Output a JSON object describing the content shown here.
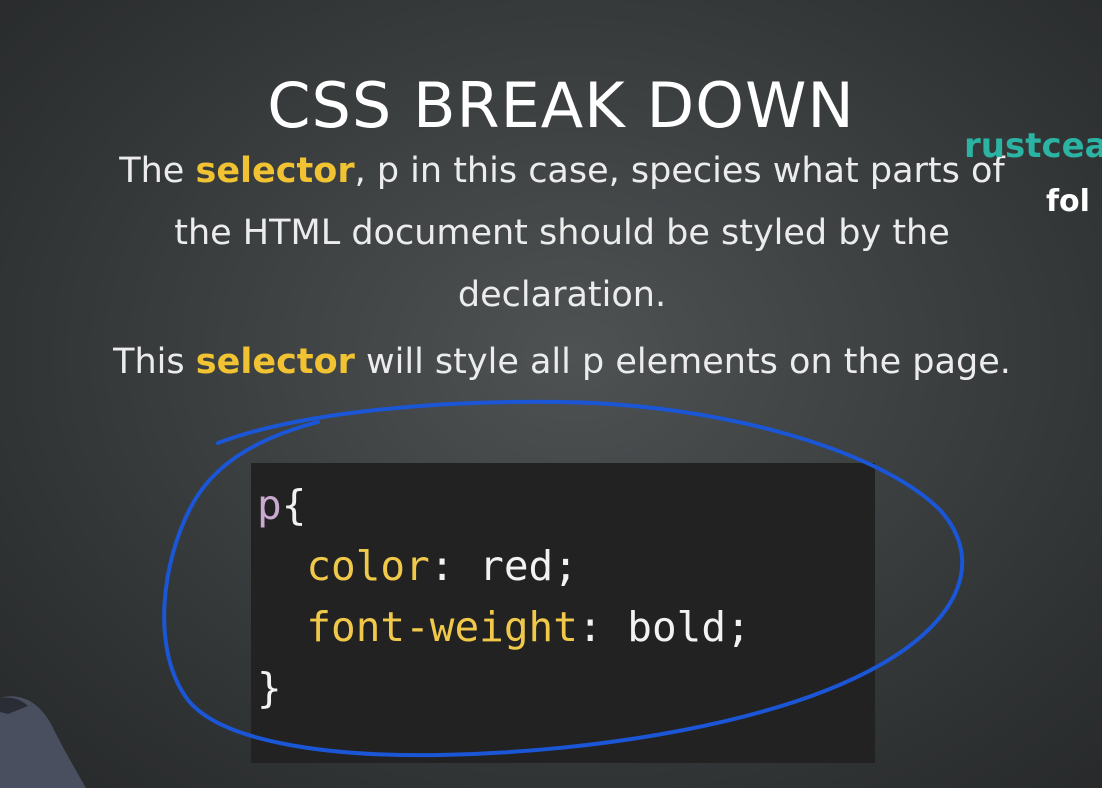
{
  "slide": {
    "title": "CSS BREAK DOWN",
    "paragraph1": {
      "line1_pre": "The ",
      "line1_keyword": "selector",
      "line1_post": ", p in this case, species what parts of",
      "line2": "the HTML document should be styled by the",
      "line3": "declaration."
    },
    "paragraph2": {
      "pre": "This ",
      "keyword": "selector",
      "post": " will style all p elements on the page."
    }
  },
  "code": {
    "selector": "p",
    "open_brace": "{",
    "declarations": [
      {
        "property": "color",
        "value": "red"
      },
      {
        "property": "font-weight",
        "value": "bold"
      }
    ],
    "close_brace": "}"
  },
  "watermark": {
    "line1": "rustcea",
    "line2": "fol"
  },
  "colors": {
    "keyword": "#f1c232",
    "annotation_stroke": "#1a56d6",
    "code_background": "#222222"
  }
}
